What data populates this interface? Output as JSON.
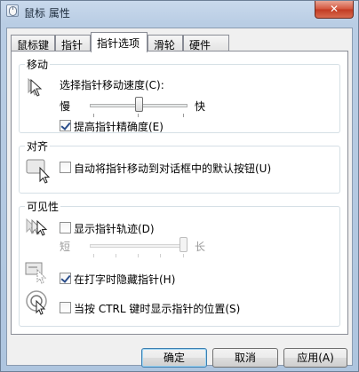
{
  "window": {
    "title": "鼠标 属性",
    "close_glyph": "✕"
  },
  "tabs": [
    {
      "label": "鼠标键",
      "active": false
    },
    {
      "label": "指针",
      "active": false
    },
    {
      "label": "指针选项",
      "active": true
    },
    {
      "label": "滑轮",
      "active": false
    },
    {
      "label": "硬件",
      "active": false
    }
  ],
  "motion": {
    "title": "移动",
    "speed_label": "选择指针移动速度(C):",
    "slow": "慢",
    "fast": "快",
    "speed_value": 0.5,
    "precision_label": "提高指针精确度(E)",
    "precision_checked": true
  },
  "snap": {
    "title": "对齐",
    "label": "自动将指针移动到对话框中的默认按钮(U)",
    "checked": false
  },
  "visibility": {
    "title": "可见性",
    "trails_label": "显示指针轨迹(D)",
    "trails_checked": false,
    "short": "短",
    "long": "长",
    "trails_value": 1.0,
    "hide_label": "在打字时隐藏指针(H)",
    "hide_checked": true,
    "ctrl_label": "当按 CTRL 键时显示指针的位置(S)",
    "ctrl_checked": false
  },
  "buttons": {
    "ok": "确定",
    "cancel": "取消",
    "apply": "应用(A)"
  }
}
